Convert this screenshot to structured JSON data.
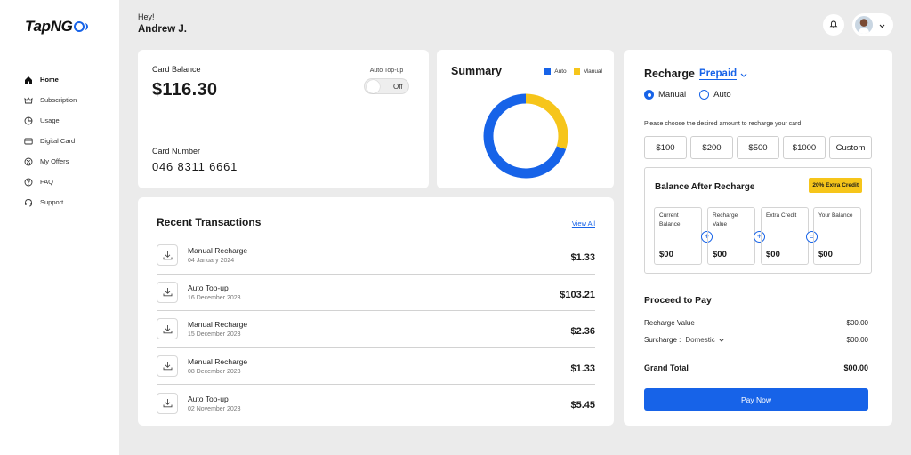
{
  "app": {
    "logo_text": "TapNG",
    "logo_suffix": ""
  },
  "sidebar": {
    "items": [
      {
        "label": "Home",
        "icon": "home-icon",
        "active": true
      },
      {
        "label": "Subscription",
        "icon": "crown-icon"
      },
      {
        "label": "Usage",
        "icon": "pie-chart-icon"
      },
      {
        "label": "Digital Card",
        "icon": "card-icon"
      },
      {
        "label": "My Offers",
        "icon": "offer-icon"
      },
      {
        "label": "FAQ",
        "icon": "question-icon"
      },
      {
        "label": "Support",
        "icon": "headset-icon"
      }
    ]
  },
  "header": {
    "greeting": "Hey!",
    "user_name": "Andrew J."
  },
  "balance": {
    "label": "Card Balance",
    "amount": "$116.30",
    "autotopup_label": "Auto Top-up",
    "toggle_state": "Off",
    "card_number_label": "Card Number",
    "card_number": "046  8311  6661"
  },
  "summary": {
    "title": "Summary",
    "legend_auto": "Auto",
    "legend_manual": "Manual",
    "auto_color": "#1763e8",
    "manual_color": "#f6c51a",
    "auto_share": 0.7,
    "manual_share": 0.3
  },
  "transactions": {
    "title": "Recent Transactions",
    "view_all": "View All",
    "items": [
      {
        "name": "Manual Recharge",
        "date": "04 January 2024",
        "amount": "$1.33"
      },
      {
        "name": "Auto Top-up",
        "date": "16 December 2023",
        "amount": "$103.21"
      },
      {
        "name": "Manual Recharge",
        "date": "15 December 2023",
        "amount": "$2.36"
      },
      {
        "name": "Manual Recharge",
        "date": "08 December 2023",
        "amount": "$1.33"
      },
      {
        "name": "Auto Top-up",
        "date": "02 November 2023",
        "amount": "$5.45"
      }
    ]
  },
  "recharge": {
    "title": "Recharge",
    "plan": "Prepaid",
    "mode_manual": "Manual",
    "mode_auto": "Auto",
    "hint": "Please choose the desired amount to recharge your card",
    "amounts": [
      "$100",
      "$200",
      "$500",
      "$1000",
      "Custom"
    ],
    "bar_title": "Balance After Recharge",
    "extra_badge": "20% Extra Credit",
    "cells": [
      {
        "label": "Current Balance",
        "value": "$00"
      },
      {
        "label": "Recharge Value",
        "value": "$00"
      },
      {
        "label": "Extra Credit",
        "value": "$00"
      },
      {
        "label": "Your Balance",
        "value": "$00"
      }
    ],
    "operators": [
      "+",
      "+",
      "="
    ],
    "proceed_title": "Proceed to Pay",
    "recharge_value_label": "Recharge Value",
    "recharge_value": "$00.00",
    "surcharge_label": "Surcharge :",
    "surcharge_option": "Domestic",
    "surcharge_value": "$00.00",
    "grand_total_label": "Grand Total",
    "grand_total": "$00.00",
    "pay_button": "Pay Now"
  }
}
